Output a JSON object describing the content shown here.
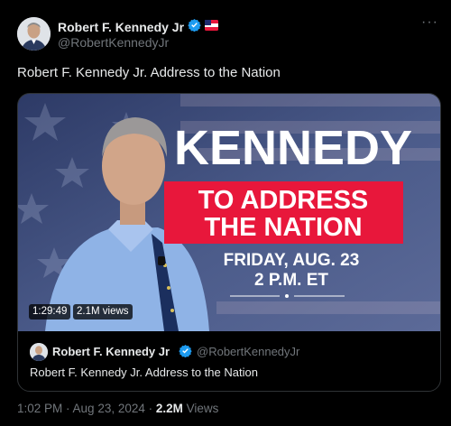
{
  "author": {
    "name": "Robert F. Kennedy Jr",
    "handle": "@RobertKennedyJr"
  },
  "icons": {
    "verified": "verified-badge-icon",
    "flag": "affiliate-flag-icon",
    "more": "more-icon"
  },
  "more_label": "···",
  "tweet": {
    "text": "Robert F. Kennedy Jr. Address to the Nation"
  },
  "media": {
    "headline": "KENNEDY",
    "banner_line1": "TO ADDRESS",
    "banner_line2": "THE NATION",
    "date_line": "FRIDAY, AUG. 23",
    "time_line": "2 P.M. ET",
    "duration": "1:29:49",
    "views": "2.1M views",
    "colors": {
      "banner": "#e8173b",
      "background": "#4a5a86",
      "text": "#ffffff"
    }
  },
  "quote": {
    "name": "Robert F. Kennedy Jr",
    "handle": "@RobertKennedyJr",
    "text": "Robert F. Kennedy Jr. Address to the Nation"
  },
  "meta": {
    "time": "1:02 PM",
    "sep1": " · ",
    "date": "Aug 23, 2024",
    "sep2": " · ",
    "views_count": "2.2M",
    "views_label": " Views"
  },
  "accent": "#1d9bf0"
}
